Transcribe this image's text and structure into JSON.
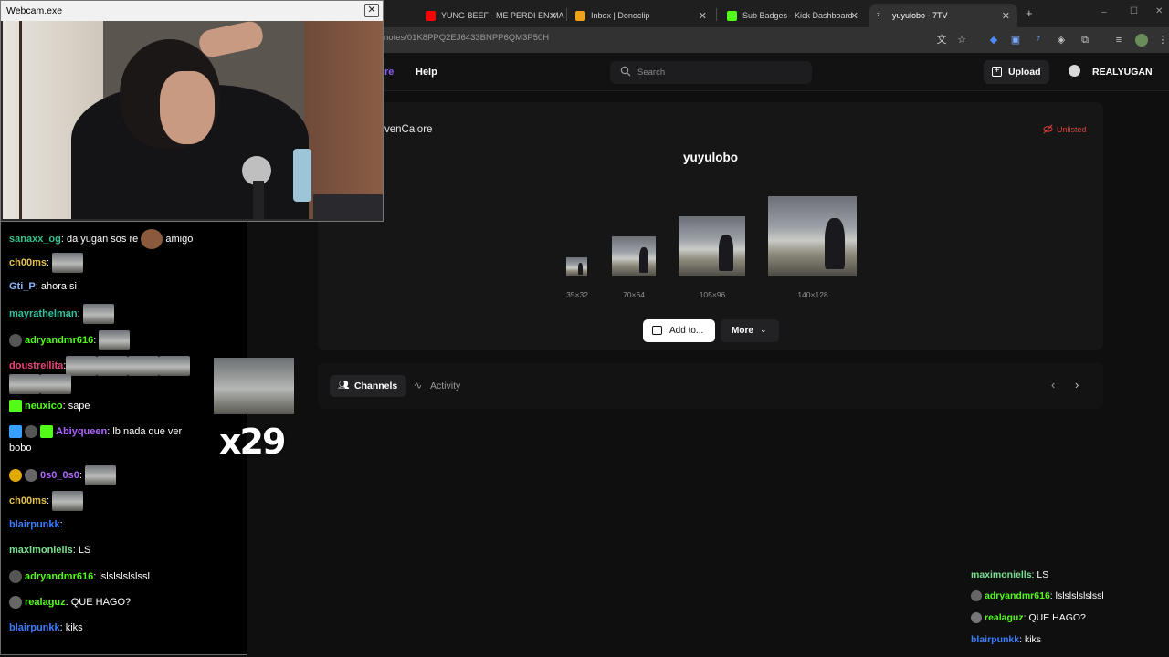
{
  "browser": {
    "tabs": [
      {
        "label": "YUNG BEEF - ME PERDI EN MA",
        "icon": "youtube-icon",
        "color": "#ff0000"
      },
      {
        "label": "Inbox | Donoclip",
        "icon": "donoclip-icon",
        "color": "#f0a31a"
      },
      {
        "label": "Sub Badges - Kick Dashboard",
        "icon": "kick-icon",
        "color": "#53fc18"
      },
      {
        "label": "yuyulobo - 7TV",
        "icon": "7tv-icon",
        "color": "#ffffff"
      }
    ],
    "new_tab": "+",
    "url": "notes/01K8PPQ2EJ6433BNPP6QM3P50H",
    "window_controls": [
      "–",
      "☐",
      "✕"
    ]
  },
  "site": {
    "nav_partial": "re",
    "nav_help": "Help",
    "search_placeholder": "Search",
    "upload_label": "Upload",
    "username": "REALYUGAN",
    "accent": "#8b5cf6"
  },
  "emote": {
    "owner": "venCalore",
    "status": "Unlisted",
    "name": "yuyulobo",
    "sizes": [
      "35×32",
      "70×64",
      "105×96",
      "140×128"
    ],
    "add_to_label": "Add to...",
    "more_label": "More"
  },
  "tabs": {
    "channels": "Channels",
    "activity": "Activity"
  },
  "webcam": {
    "title": "Webcam.exe"
  },
  "chat": {
    "messages": [
      {
        "user": "sanaxx_og",
        "color": "#33c28c",
        "text": ": da yugan sos re ",
        "tail": " amigo"
      },
      {
        "user": "ch00ms",
        "color": "#e5c14a",
        "text": ": "
      },
      {
        "user": "Gti_P",
        "color": "#8ab4ff",
        "text": ": ahora si"
      },
      {
        "user": "mayrathelman",
        "color": "#33c2a0",
        "text": ": "
      },
      {
        "user": "adryandmr616",
        "color": "#53fc18",
        "text": ": "
      },
      {
        "user": "doustrellita",
        "color": "#e8447a",
        "text": ":"
      },
      {
        "user": "neuxico",
        "color": "#53fc18",
        "text": ": sape"
      },
      {
        "user": "Abiyqueen",
        "color": "#b064ff",
        "text": ": lb nada que ver",
        "line2": "bobo"
      },
      {
        "user": "0s0_0s0",
        "color": "#b064ff",
        "text": ": "
      },
      {
        "user": "ch00ms",
        "color": "#e5c14a",
        "text": ": "
      },
      {
        "user": "blairpunkk",
        "color": "#3d7dff",
        "text": ":"
      },
      {
        "user": "maximoniells",
        "color": "#78e08f",
        "text": ": LS"
      },
      {
        "user": "adryandmr616",
        "color": "#53fc18",
        "text": ": lslslslslslssl"
      },
      {
        "user": "realaguz",
        "color": "#53fc18",
        "text": ": QUE HAGO?"
      },
      {
        "user": "blairpunkk",
        "color": "#3d7dff",
        "text": ": kiks"
      }
    ],
    "combo": "x29"
  },
  "chat_right": {
    "messages": [
      {
        "user": "maximoniells",
        "color": "#78e08f",
        "text": ": LS"
      },
      {
        "user": "adryandmr616",
        "color": "#53fc18",
        "text": ": lslslslslslssl"
      },
      {
        "user": "realaguz",
        "color": "#53fc18",
        "text": ": QUE HAGO?"
      },
      {
        "user": "blairpunkk",
        "color": "#3d7dff",
        "text": ": kiks"
      }
    ]
  }
}
